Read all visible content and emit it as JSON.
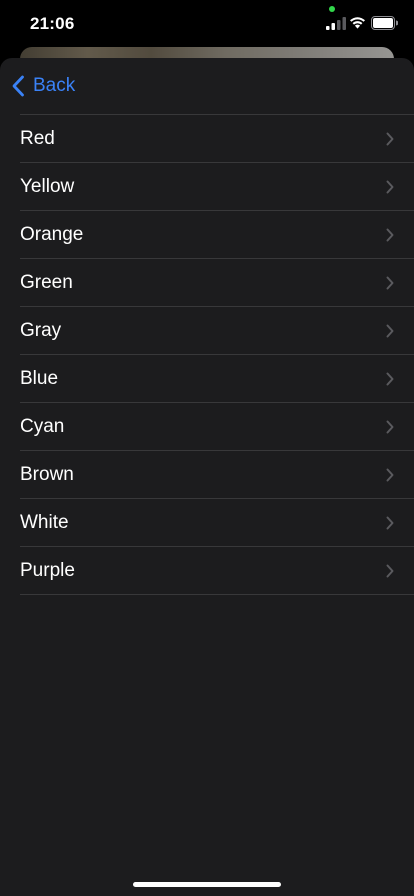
{
  "status_bar": {
    "time": "21:06"
  },
  "icons": {
    "signal": "cellular-signal-icon",
    "wifi": "wifi-icon",
    "battery": "battery-icon",
    "back": "chevron-left-icon",
    "disclosure": "chevron-right-icon"
  },
  "colors": {
    "accent": "#3a82f7",
    "sheet_background": "#1c1c1e",
    "separator": "#38383a",
    "chevron": "#5a5a5e",
    "privacy_indicator": "#32d74b"
  },
  "nav": {
    "back_label": "Back"
  },
  "list": {
    "items": [
      {
        "label": "Red"
      },
      {
        "label": "Yellow"
      },
      {
        "label": "Orange"
      },
      {
        "label": "Green"
      },
      {
        "label": "Gray"
      },
      {
        "label": "Blue"
      },
      {
        "label": "Cyan"
      },
      {
        "label": "Brown"
      },
      {
        "label": "White"
      },
      {
        "label": "Purple"
      }
    ]
  }
}
